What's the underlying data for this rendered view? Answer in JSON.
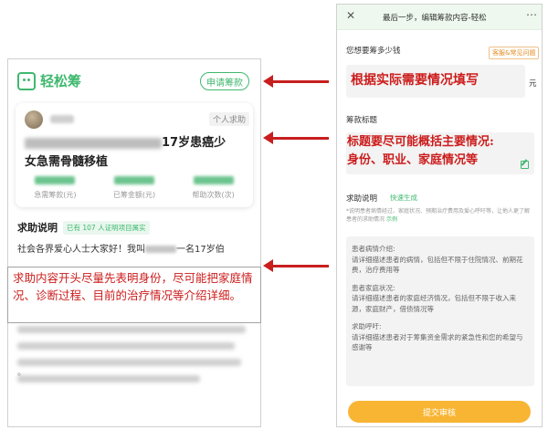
{
  "left_phone": {
    "brand": "轻松筹",
    "apply_button": "申请筹款",
    "card": {
      "tag": "个人求助",
      "title_visible": "17岁患癌少",
      "title_line2": "女急需骨髓移植",
      "stats": [
        {
          "label": "急需筹款(元)"
        },
        {
          "label": "已筹金额(元)"
        },
        {
          "label": "帮助次数(次)"
        }
      ]
    },
    "section": {
      "title": "求助说明",
      "badge": "已有 107 人证明项目属实",
      "text_start": "社会各界爱心人士大家好！我叫",
      "text_end": "一名17岁伯"
    },
    "dot": "。",
    "overlay_note": "求助内容开头尽量先表明身份，尽可能把家庭情况、诊断过程、目前的治疗情况等介绍详细。"
  },
  "right_phone": {
    "header": {
      "close_icon": "close-icon",
      "title": "最后一步，编辑筹款内容-轻松",
      "more_icon": "more-icon"
    },
    "amount": {
      "label": "您想要筹多少钱",
      "help_tag": "客服&常见问题",
      "unit": "元",
      "overlay": "根据实际需要情况填写"
    },
    "title_field": {
      "label": "筹款标题",
      "overlay_line1": "标题要尽可能概括主要情况:",
      "overlay_line2": "身份、职业、家庭情况等"
    },
    "description": {
      "label": "求助说明",
      "quick_link": "快速生成",
      "note": "*说明患者病情经过、家庭状况、预期治疗费用及爱心呼吁等，让他人更了解患者的求助情况",
      "note_link": "示例",
      "blocks": [
        {
          "head": "患者病情介绍:",
          "body": "请详细描述患者的病情，包括但不限于住院情况、前期花费，治疗费用等"
        },
        {
          "head": "患者家庭状况:",
          "body": "请详细描述患者的家庭经济情况，包括但不限于收入来源，家庭财产，借债情况等"
        },
        {
          "head": "求助呼吁:",
          "body": "请详细描述患者对于筹集资金需求的紧急性和您的希望与感谢等"
        }
      ]
    },
    "submit_button": "提交审核"
  },
  "colors": {
    "brand_green": "#3fb86e",
    "annotation_red": "#cc1c1c",
    "submit_yellow": "#f8b534"
  }
}
